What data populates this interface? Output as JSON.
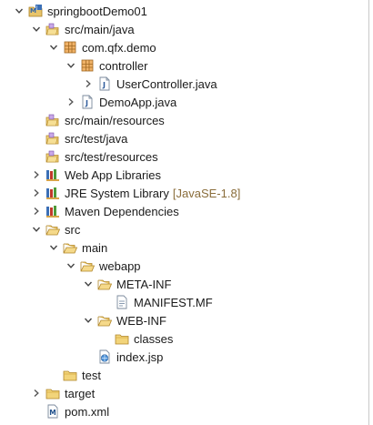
{
  "project_tree": {
    "items": [
      {
        "label": "springbootDemo01",
        "decoration": "",
        "depth": 0,
        "toggle": "expanded",
        "icon": "maven-project-icon",
        "name": "tree-item-springbootdemo01"
      },
      {
        "label": "src/main/java",
        "decoration": "",
        "depth": 1,
        "toggle": "expanded",
        "icon": "source-folder-icon",
        "name": "tree-item-src-main-java"
      },
      {
        "label": "com.qfx.demo",
        "decoration": "",
        "depth": 2,
        "toggle": "expanded",
        "icon": "package-icon",
        "name": "tree-item-com-qfx-demo"
      },
      {
        "label": "controller",
        "decoration": "",
        "depth": 3,
        "toggle": "expanded",
        "icon": "package-icon",
        "name": "tree-item-controller"
      },
      {
        "label": "UserController.java",
        "decoration": "",
        "depth": 4,
        "toggle": "collapsed",
        "icon": "java-file-icon",
        "name": "tree-item-usercontroller-java"
      },
      {
        "label": "DemoApp.java",
        "decoration": "",
        "depth": 3,
        "toggle": "collapsed",
        "icon": "java-file-icon",
        "name": "tree-item-demoapp-java"
      },
      {
        "label": "src/main/resources",
        "decoration": "",
        "depth": 1,
        "toggle": "none",
        "icon": "source-folder-icon",
        "name": "tree-item-src-main-resources"
      },
      {
        "label": "src/test/java",
        "decoration": "",
        "depth": 1,
        "toggle": "none",
        "icon": "source-folder-icon",
        "name": "tree-item-src-test-java"
      },
      {
        "label": "src/test/resources",
        "decoration": "",
        "depth": 1,
        "toggle": "none",
        "icon": "source-folder-icon",
        "name": "tree-item-src-test-resources"
      },
      {
        "label": "Web App Libraries",
        "decoration": "",
        "depth": 1,
        "toggle": "collapsed",
        "icon": "library-icon",
        "name": "tree-item-web-app-libraries"
      },
      {
        "label": "JRE System Library",
        "decoration": "[JavaSE-1.8]",
        "depth": 1,
        "toggle": "collapsed",
        "icon": "library-icon",
        "name": "tree-item-jre-system-library"
      },
      {
        "label": "Maven Dependencies",
        "decoration": "",
        "depth": 1,
        "toggle": "collapsed",
        "icon": "library-icon",
        "name": "tree-item-maven-dependencies"
      },
      {
        "label": "src",
        "decoration": "",
        "depth": 1,
        "toggle": "expanded",
        "icon": "folder-open-icon",
        "name": "tree-item-src"
      },
      {
        "label": "main",
        "decoration": "",
        "depth": 2,
        "toggle": "expanded",
        "icon": "folder-open-icon",
        "name": "tree-item-main"
      },
      {
        "label": "webapp",
        "decoration": "",
        "depth": 3,
        "toggle": "expanded",
        "icon": "folder-open-icon",
        "name": "tree-item-webapp"
      },
      {
        "label": "META-INF",
        "decoration": "",
        "depth": 4,
        "toggle": "expanded",
        "icon": "folder-open-icon",
        "name": "tree-item-meta-inf"
      },
      {
        "label": "MANIFEST.MF",
        "decoration": "",
        "depth": 5,
        "toggle": "none",
        "icon": "manifest-file-icon",
        "name": "tree-item-manifest-mf"
      },
      {
        "label": "WEB-INF",
        "decoration": "",
        "depth": 4,
        "toggle": "expanded",
        "icon": "folder-open-icon",
        "name": "tree-item-web-inf"
      },
      {
        "label": "classes",
        "decoration": "",
        "depth": 5,
        "toggle": "none",
        "icon": "folder-icon",
        "name": "tree-item-classes"
      },
      {
        "label": "index.jsp",
        "decoration": "",
        "depth": 4,
        "toggle": "none",
        "icon": "jsp-file-icon",
        "name": "tree-item-index-jsp"
      },
      {
        "label": "test",
        "decoration": "",
        "depth": 2,
        "toggle": "none",
        "icon": "folder-icon",
        "name": "tree-item-test"
      },
      {
        "label": "target",
        "decoration": "",
        "depth": 1,
        "toggle": "collapsed",
        "icon": "folder-icon",
        "name": "tree-item-target"
      },
      {
        "label": "pom.xml",
        "decoration": "",
        "depth": 1,
        "toggle": "none",
        "icon": "maven-pom-icon",
        "name": "tree-item-pom-xml"
      }
    ]
  }
}
